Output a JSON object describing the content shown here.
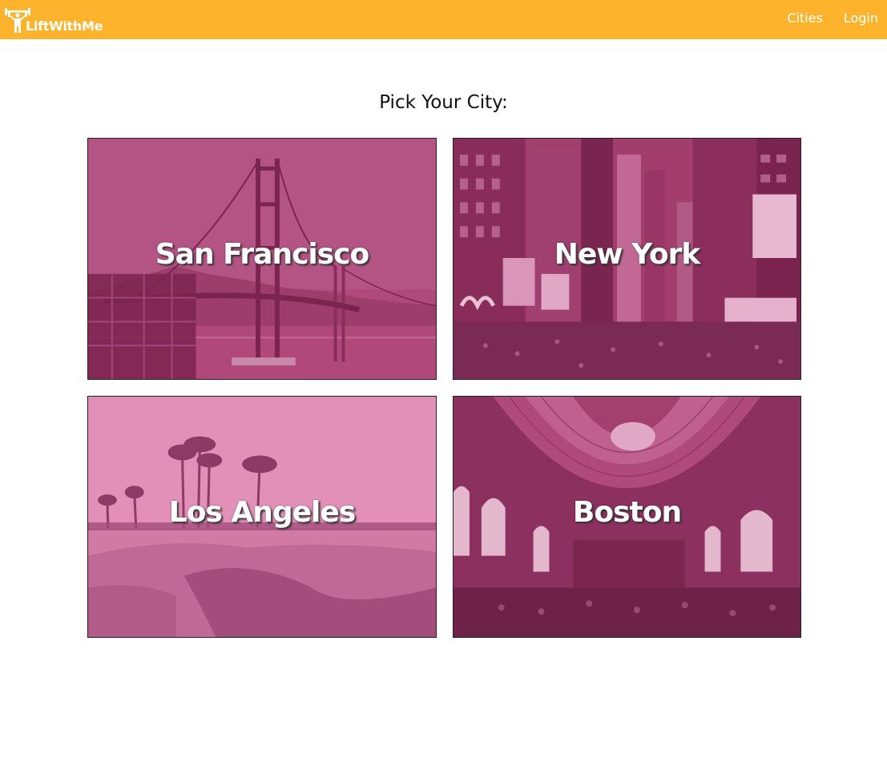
{
  "navbar": {
    "brand": "LiftWithMe",
    "brand_icon": "weightlifter-icon",
    "links": [
      "Cities",
      "Login"
    ],
    "background": "#fdb32b"
  },
  "main": {
    "title": "Pick Your City:",
    "overlay_color": "#b5386e",
    "cities": [
      {
        "name": "San Francisco"
      },
      {
        "name": "New York"
      },
      {
        "name": "Los Angeles"
      },
      {
        "name": "Boston"
      }
    ]
  }
}
